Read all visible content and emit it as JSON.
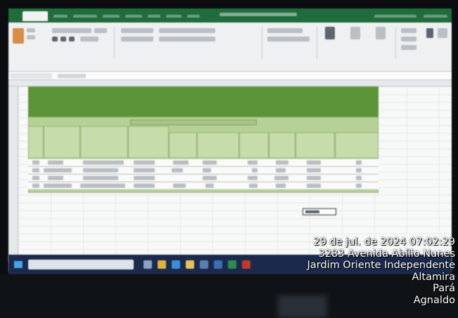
{
  "photo_overlay": {
    "datetime": "29 de jul. de 2024 07:02:29",
    "address": "3283 Avenida Abílio Nunes",
    "neighborhood": "Jardim Oriente Independente",
    "city": "Altamira",
    "state": "Pará",
    "name": "Agnaldo"
  },
  "colors": {
    "excel_green": "#1f6c3d",
    "banner_green": "#5b9338",
    "header_green": "#b6d197",
    "taskbar": "#1b2a4c"
  }
}
